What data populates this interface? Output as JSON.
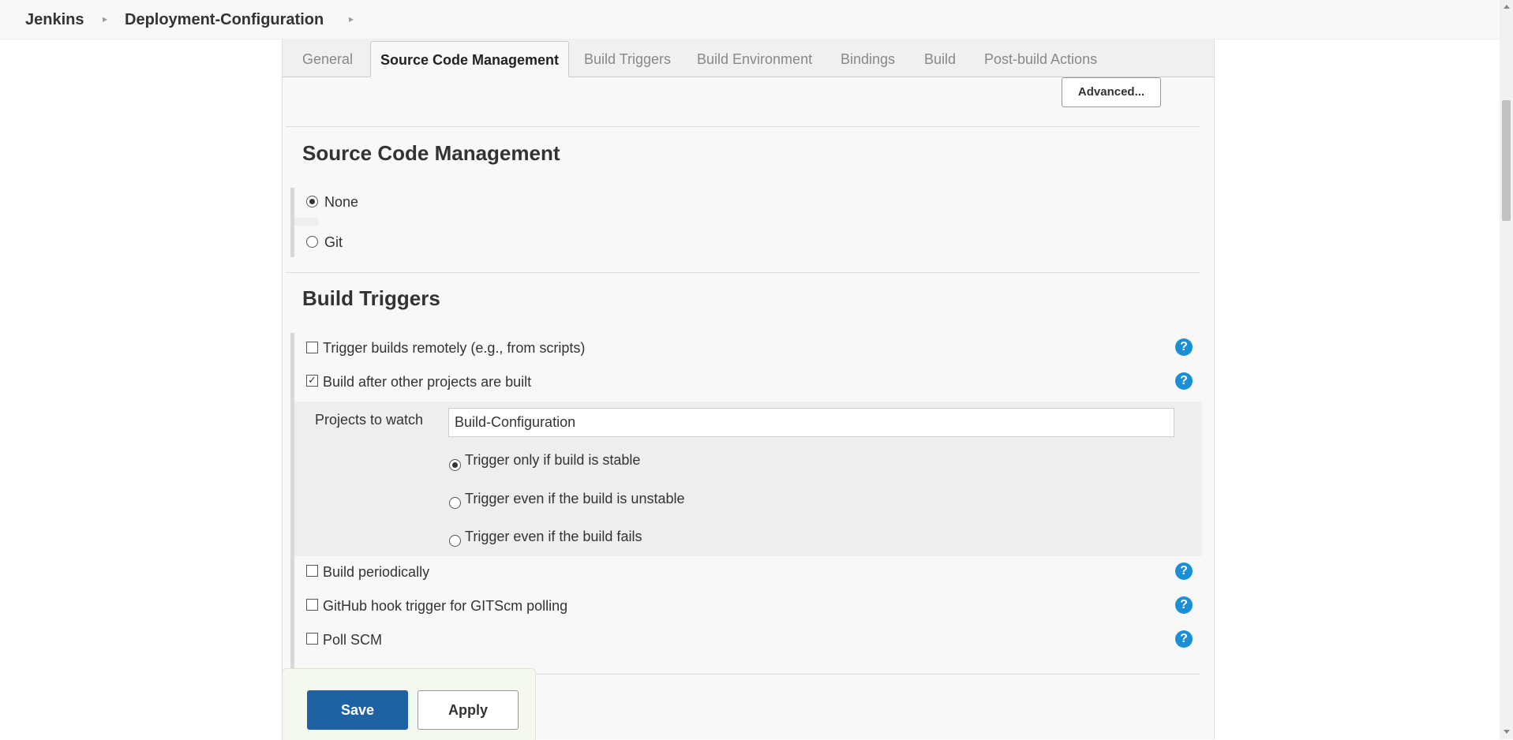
{
  "breadcrumb": {
    "home": "Jenkins",
    "job": "Deployment-Configuration"
  },
  "tabs": [
    {
      "label": "General",
      "active": false
    },
    {
      "label": "Source Code Management",
      "active": true
    },
    {
      "label": "Build Triggers",
      "active": false
    },
    {
      "label": "Build Environment",
      "active": false
    },
    {
      "label": "Bindings",
      "active": false
    },
    {
      "label": "Build",
      "active": false
    },
    {
      "label": "Post-build Actions",
      "active": false
    }
  ],
  "advanced_label": "Advanced...",
  "scm": {
    "title": "Source Code Management",
    "options": [
      {
        "label": "None",
        "selected": true
      },
      {
        "label": "Git",
        "selected": false
      }
    ]
  },
  "triggers": {
    "title": "Build Triggers",
    "items": [
      {
        "label": "Trigger builds remotely (e.g., from scripts)",
        "checked": false
      },
      {
        "label": "Build after other projects are built",
        "checked": true
      },
      {
        "label": "Build periodically",
        "checked": false
      },
      {
        "label": "GitHub hook trigger for GITScm polling",
        "checked": false
      },
      {
        "label": "Poll SCM",
        "checked": false
      }
    ],
    "projects_to_watch": {
      "label": "Projects to watch",
      "value": "Build-Configuration"
    },
    "conditions": [
      {
        "label": "Trigger only if build is stable",
        "selected": true
      },
      {
        "label": "Trigger even if the build is unstable",
        "selected": false
      },
      {
        "label": "Trigger even if the build fails",
        "selected": false
      }
    ]
  },
  "actions": {
    "save": "Save",
    "apply": "Apply"
  },
  "colors": {
    "primary": "#1f62a4",
    "help": "#1b8fd6"
  },
  "icons": {
    "help": "question-circle-icon",
    "breadcrumb_sep": "caret-right-icon"
  }
}
